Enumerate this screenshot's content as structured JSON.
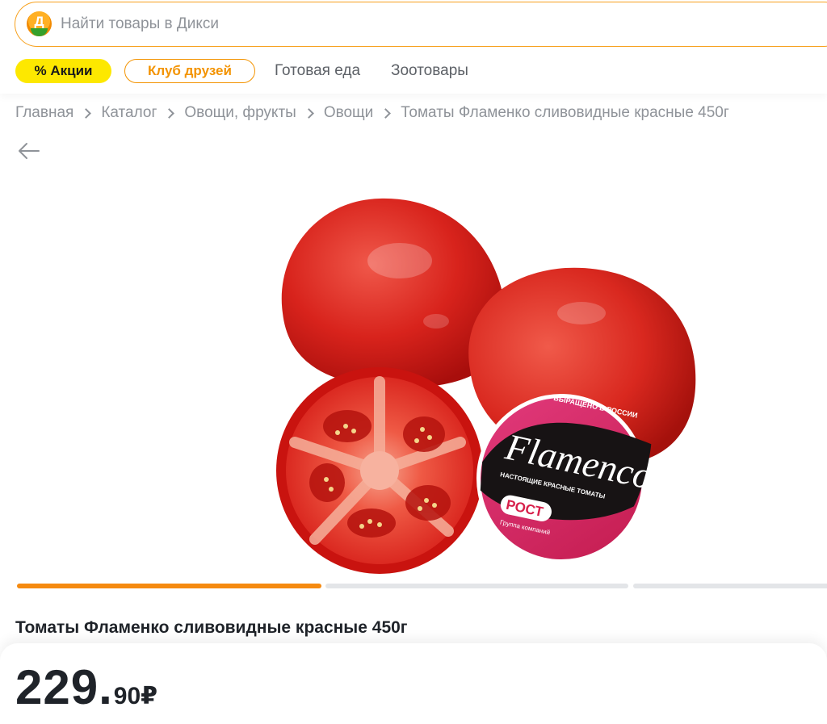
{
  "search": {
    "logo_letter": "Д",
    "placeholder": "Найти товары в Дикси"
  },
  "nav": {
    "sale_chip": "% Акции",
    "club_chip": "Клуб друзей",
    "links": [
      "Готовая еда",
      "Зоотовары"
    ]
  },
  "breadcrumbs": [
    "Главная",
    "Каталог",
    "Овощи, фрукты",
    "Овощи",
    "Томаты Фламенко сливовидные красные 450г"
  ],
  "product": {
    "image_label": {
      "top_band": "ВЫРАЩЕНО В РОССИИ",
      "brand": "Flamenco",
      "tagline": "НАСТОЯЩИЕ КРАСНЫЕ ТОМАТЫ",
      "maker": "РОСТ",
      "maker_sub": "Группа компаний"
    },
    "gallery": {
      "images_total": 3,
      "active_index": 1
    },
    "title": "Томаты Фламенко сливовидные красные 450г",
    "price": {
      "integer": "229",
      "separator": ".",
      "fraction": "90",
      "currency": "₽"
    }
  },
  "colors": {
    "accent_orange": "#f58a10",
    "sale_yellow": "#fde800",
    "text": "#1f2329",
    "muted": "#8f9399"
  },
  "icons": {
    "logo": "dixy-logo-icon",
    "breadcrumb_separator": "chevron-right-icon",
    "back": "arrow-left-icon"
  }
}
